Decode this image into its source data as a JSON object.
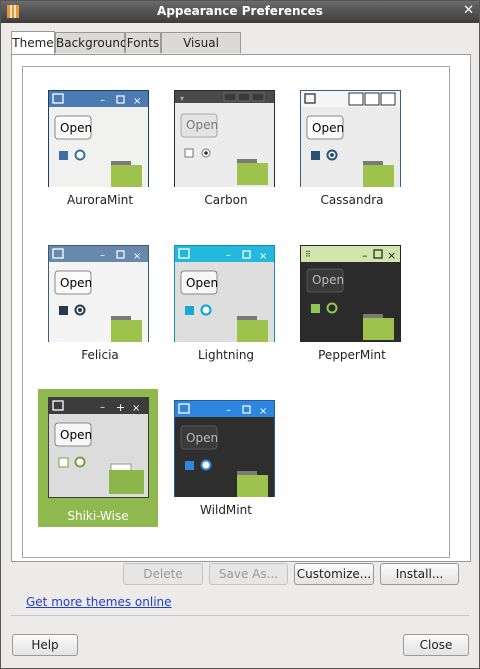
{
  "window": {
    "title": "Appearance Preferences"
  },
  "tabs": [
    {
      "label": "Theme",
      "active": true
    },
    {
      "label": "Background",
      "active": false
    },
    {
      "label": "Fonts",
      "active": false
    },
    {
      "label": "Visual Effects",
      "active": false
    }
  ],
  "themes": [
    {
      "name": "AuroraMint",
      "selected": false
    },
    {
      "name": "Carbon",
      "selected": false
    },
    {
      "name": "Cassandra",
      "selected": false
    },
    {
      "name": "Felicia",
      "selected": false
    },
    {
      "name": "Lightning",
      "selected": false
    },
    {
      "name": "PepperMint",
      "selected": false
    },
    {
      "name": "Shiki-Wise",
      "selected": true
    },
    {
      "name": "WildMint",
      "selected": false
    }
  ],
  "preview": {
    "open_label": "Open"
  },
  "actions": {
    "delete": "Delete",
    "save_as": "Save As...",
    "customize": "Customize...",
    "install": "Install..."
  },
  "link": {
    "more_themes": "Get more themes online"
  },
  "footer": {
    "help": "Help",
    "close": "Close"
  },
  "colors": {
    "selection": "#8fb84f",
    "link": "#1f3fcc"
  }
}
